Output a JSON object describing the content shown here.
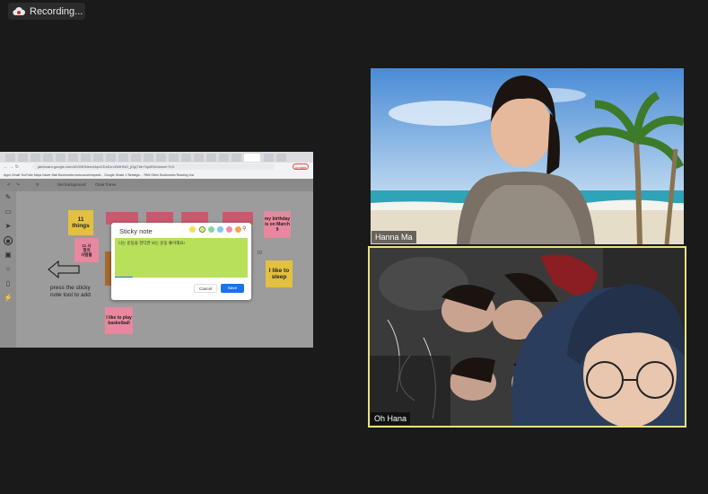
{
  "recording": {
    "label": "Recording..."
  },
  "shared_screen": {
    "url": "jamboard.google.com/d/1WtHNem4bpvXDxEzrvDWHNG_jDjqT6eYhp6l0b/viewer?f=0",
    "update_label": "Update",
    "bookmarks": "Apps  Gmail  YouTube  Maps  Naver  Mail  Bookmarks  www.woolenspede...  Google  Grade 1 Strategic...  YBM  Other Bookmarks  Reading List",
    "toolbar": {
      "set_background": "Set background",
      "clear_frame": "Clear frame"
    },
    "stickies": [
      {
        "text": "11 things",
        "color": "#e3c13f"
      },
      {
        "text": "11 시\n항의\n사람들",
        "color": "#e8889e"
      },
      {
        "text": "my birthday is on March 9",
        "color": "#e8889e"
      },
      {
        "text": "I like to sleep",
        "color": "#e3c13f"
      },
      {
        "text": "I like to play basketball",
        "color": "#e8889e"
      },
      {
        "text": "10",
        "color": "#9c9c9c"
      }
    ],
    "hint": "press the sticky note tool to add",
    "dialog": {
      "title": "Sticky note",
      "text": "나는 운동을 한다면 보는 운동 좋아해요!",
      "cancel": "Cancel",
      "save": "Save",
      "swatches": [
        "#f5e05a",
        "#f5c842",
        "#8bd3a1",
        "#7ec8f0",
        "#f28bb0",
        "#f5a742"
      ]
    }
  },
  "participants": [
    {
      "name": "Hanna Ma"
    },
    {
      "name": "Oh Hana"
    }
  ]
}
